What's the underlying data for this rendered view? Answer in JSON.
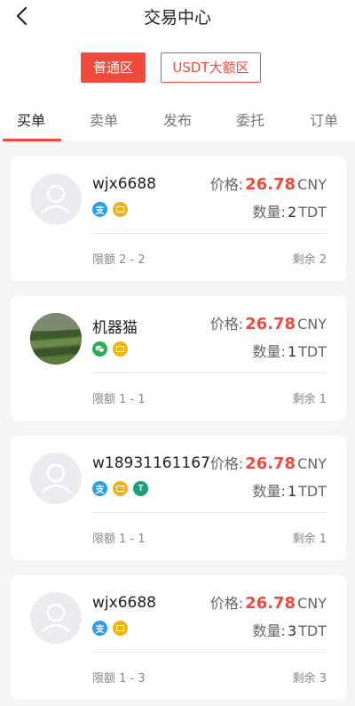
{
  "header": {
    "title": "交易中心",
    "zones": {
      "normal": "普通区",
      "usdt": "USDT大额区"
    }
  },
  "tabs": [
    "买单",
    "卖单",
    "发布",
    "委托",
    "订单"
  ],
  "labels": {
    "price": "价格:",
    "quantity": "数量:",
    "price_unit": "CNY",
    "quantity_unit": "TDT"
  },
  "orders": [
    {
      "username": "wjx6688",
      "price": "26.78",
      "quantity": "2",
      "limit": "限额 2 - 2",
      "remaining": "剩余 2",
      "payments": [
        "alipay",
        "card"
      ],
      "avatar": "default"
    },
    {
      "username": "机器猫",
      "price": "26.78",
      "quantity": "1",
      "limit": "限额 1 - 1",
      "remaining": "剩余 1",
      "payments": [
        "wechat",
        "card"
      ],
      "avatar": "photo"
    },
    {
      "username": "w18931161167",
      "price": "26.78",
      "quantity": "1",
      "limit": "限额 1 - 1",
      "remaining": "剩余 1",
      "payments": [
        "alipay",
        "card",
        "usdt"
      ],
      "avatar": "default"
    },
    {
      "username": "wjx6688",
      "price": "26.78",
      "quantity": "3",
      "limit": "限额 1 - 3",
      "remaining": "剩余 3",
      "payments": [
        "alipay",
        "card"
      ],
      "avatar": "default"
    }
  ],
  "colors": {
    "accent": "#f04a3c",
    "alipay": "#2b9df0",
    "card": "#f0b419",
    "wechat": "#22b14c",
    "usdt": "#1d9e7a"
  }
}
